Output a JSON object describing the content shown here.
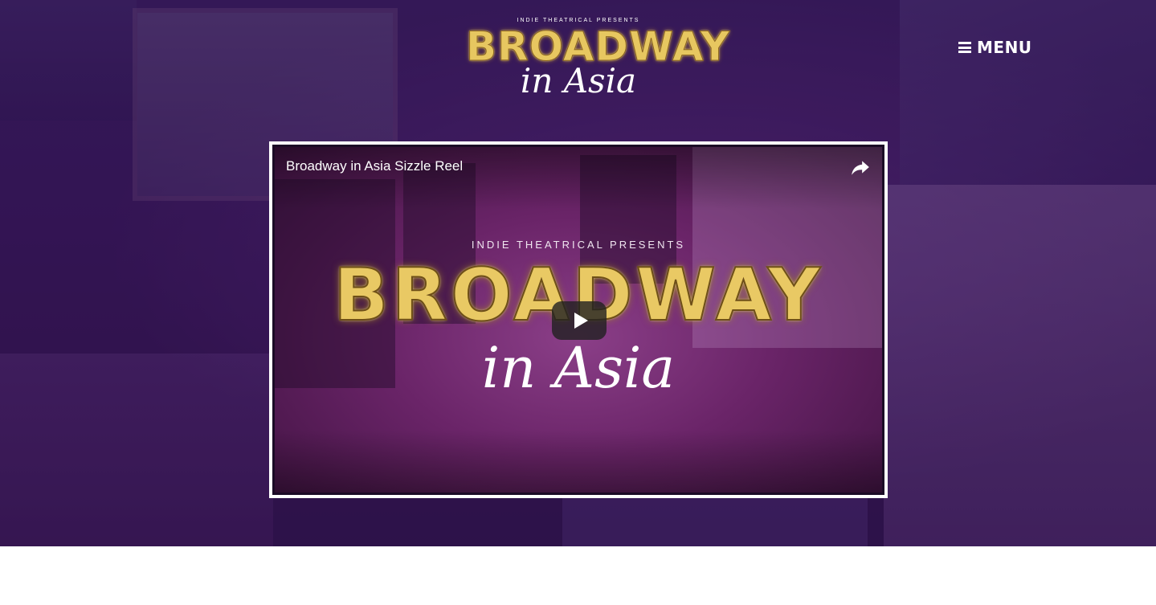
{
  "header": {
    "logo": {
      "presents": "INDIE THEATRICAL PRESENTS",
      "title_line1": "BROADWAY",
      "title_line2": "in Asia"
    },
    "menu": {
      "icon": "hamburger-icon",
      "label": "MENU"
    }
  },
  "video": {
    "title": "Broadway in Asia Sizzle Reel",
    "share_icon": "share-icon",
    "play_icon": "play-icon",
    "thumbnail": {
      "presents": "INDIE THEATRICAL PRESENTS",
      "title_line1": "BROADWAY",
      "title_line2": "in Asia"
    }
  },
  "colors": {
    "hero_purple": "#3a1a5c",
    "logo_gold": "#e7c760",
    "text_white": "#ffffff"
  }
}
